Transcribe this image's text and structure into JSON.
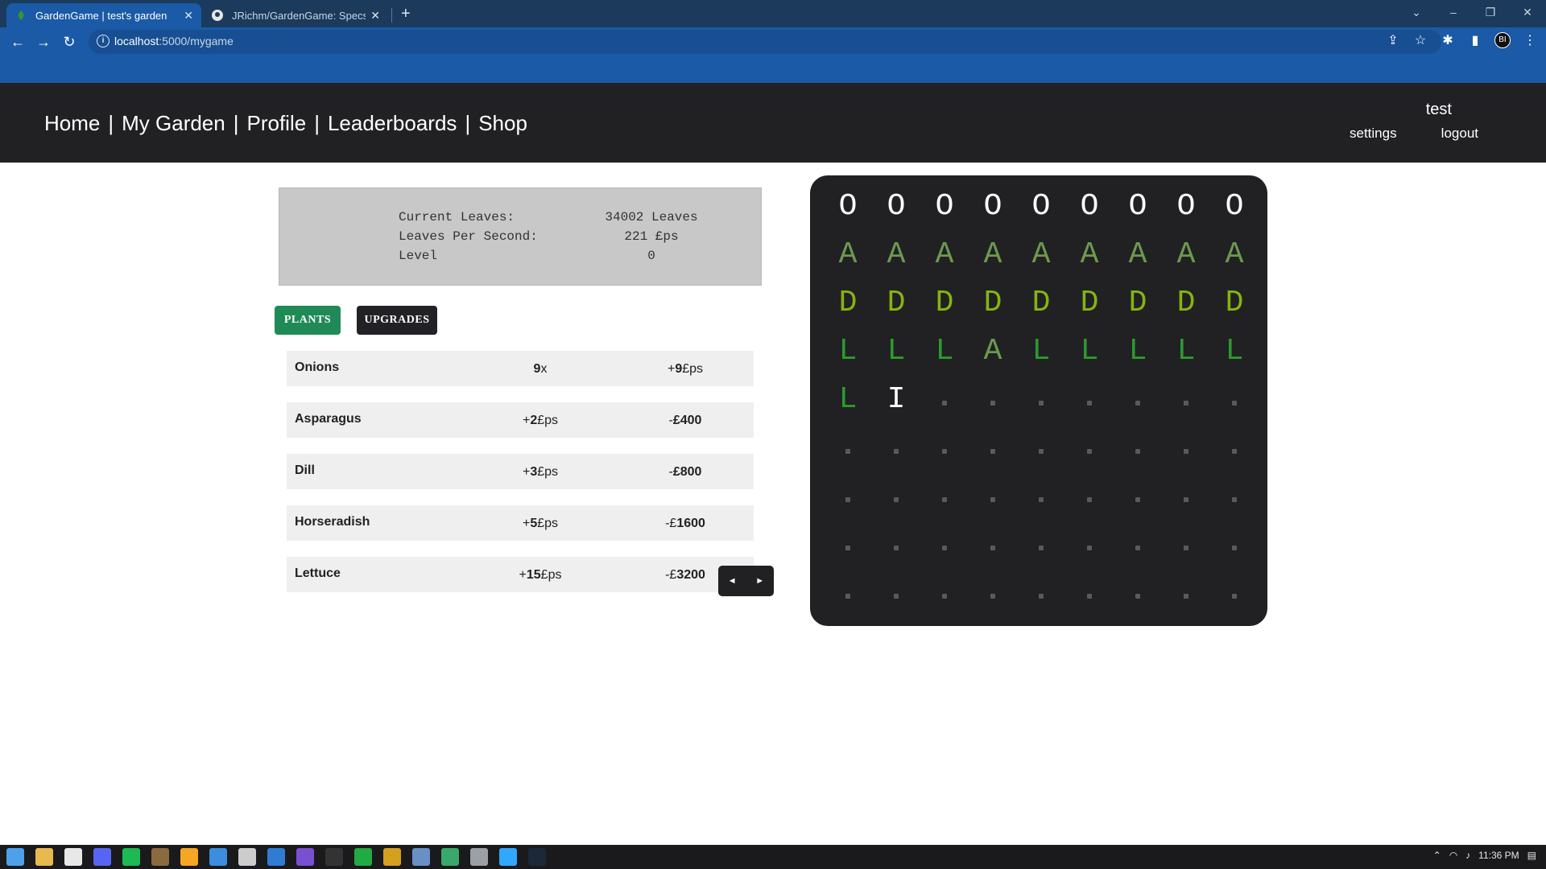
{
  "browser": {
    "tabs": [
      {
        "title": "GardenGame | test's garden",
        "active": true
      },
      {
        "title": "JRichm/GardenGame: Specs Cap",
        "active": false
      }
    ],
    "url_host": "localhost",
    "url_path": ":5000/mygame",
    "profile_initials": "BI"
  },
  "nav": {
    "links": [
      "Home",
      "My Garden",
      "Profile",
      "Leaderboards",
      "Shop"
    ],
    "separator": "|",
    "username": "test",
    "settings": "settings",
    "logout": "logout"
  },
  "stats": {
    "rows": [
      {
        "label": "Current Leaves:",
        "value": "34002 Leaves"
      },
      {
        "label": "Leaves Per Second:",
        "value": "221 £ps"
      },
      {
        "label": "Level",
        "value": "0"
      }
    ]
  },
  "tabs": {
    "plants": "PLANTS",
    "upgrades": "UPGRADES"
  },
  "plants": [
    {
      "name": "Onions",
      "col2_bold": "9",
      "col2_rest": "x",
      "col3_pre": "+",
      "col3_bold": "9",
      "col3_rest": "£ps"
    },
    {
      "name": "Asparagus",
      "col2_pre": "+",
      "col2_bold": "2",
      "col2_rest": "£ps",
      "col3_pre": "-",
      "col3_bold": "£400"
    },
    {
      "name": "Dill",
      "col2_pre": "+",
      "col2_bold": "3",
      "col2_rest": "£ps",
      "col3_pre": "-",
      "col3_bold": "£800"
    },
    {
      "name": "Horseradish",
      "col2_pre": "+",
      "col2_bold": "5",
      "col2_rest": "£ps",
      "col3_pre": "-£",
      "col3_bold": "1600"
    },
    {
      "name": "Lettuce",
      "col2_pre": "+",
      "col2_bold": "15",
      "col2_rest": "£ps",
      "col3_pre": "-£",
      "col3_bold": "3200"
    }
  ],
  "pager": {
    "prev": "◄",
    "next": "►"
  },
  "garden": {
    "rows": [
      [
        "O",
        "O",
        "O",
        "O",
        "O",
        "O",
        "O",
        "O",
        "O"
      ],
      [
        "A",
        "A",
        "A",
        "A",
        "A",
        "A",
        "A",
        "A",
        "A"
      ],
      [
        "D",
        "D",
        "D",
        "D",
        "D",
        "D",
        "D",
        "D",
        "D"
      ],
      [
        "L",
        "L",
        "L",
        "A",
        "L",
        "L",
        "L",
        "L",
        "L"
      ],
      [
        "L",
        "I",
        ".",
        ".",
        ".",
        ".",
        ".",
        ".",
        "."
      ],
      [
        ".",
        ".",
        ".",
        ".",
        ".",
        ".",
        ".",
        ".",
        "."
      ],
      [
        ".",
        ".",
        ".",
        ".",
        ".",
        ".",
        ".",
        ".",
        "."
      ],
      [
        ".",
        ".",
        ".",
        ".",
        ".",
        ".",
        ".",
        ".",
        "."
      ],
      [
        ".",
        ".",
        ".",
        ".",
        ".",
        ".",
        ".",
        ".",
        "."
      ]
    ],
    "colors": {
      "O": "#ffffff",
      "A": "#6b9a4e",
      "D": "#86b410",
      "L": "#2d9a2d",
      "I": "#ffffff"
    }
  },
  "taskbar": {
    "time": "11:36 PM",
    "icon_colors": [
      "#4ea1e8",
      "#e8b94e",
      "#e8e8e8",
      "#5865f2",
      "#1db954",
      "#8b6a3e",
      "#f5a623",
      "#3c8dde",
      "#cccccc",
      "#2e7dd1",
      "#7a4fd1",
      "#333333",
      "#22aa44",
      "#d4a020",
      "#6a8fc4",
      "#3aa86b",
      "#9aa0a6",
      "#31a8ff",
      "#1b2838"
    ]
  }
}
